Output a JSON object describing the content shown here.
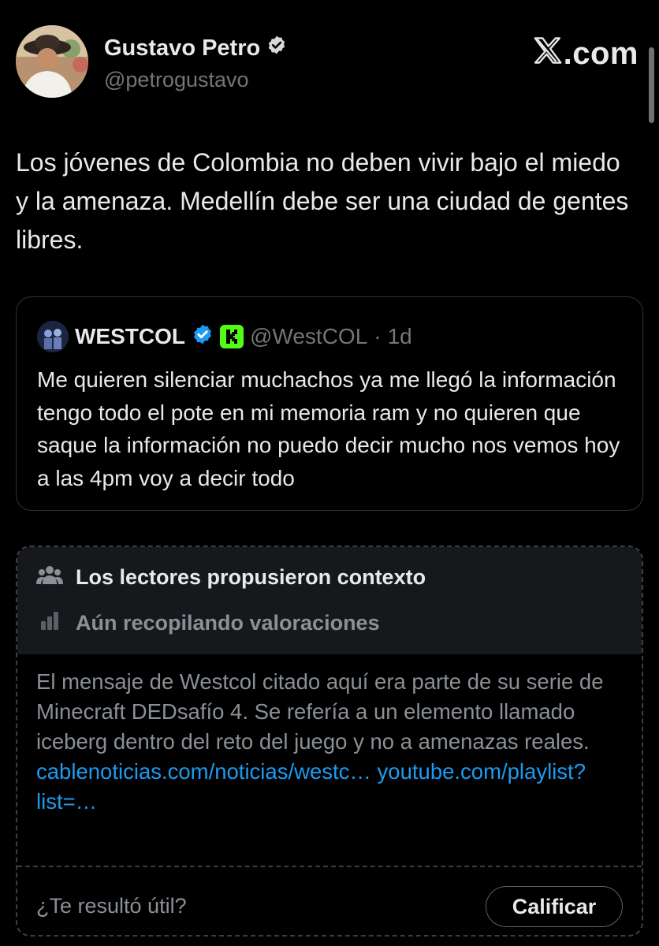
{
  "author": {
    "name": "Gustavo Petro",
    "handle": "@petrogustavo",
    "verified": true
  },
  "brand": {
    "domain_suffix": ".com"
  },
  "tweet": {
    "text": "Los jóvenes de Colombia no deben vivir bajo el miedo y la amenaza. Medellín debe ser una ciudad de gentes libres."
  },
  "quoted": {
    "name": "WESTCOL",
    "handle": "@WestCOL",
    "separator": "·",
    "time": "1d",
    "text": "Me quieren silenciar muchachos ya me llegó la información tengo todo el pote en mi memoria ram y no quieren que saque la información no puedo decir mucho nos vemos hoy a las 4pm voy a decir todo"
  },
  "community_note": {
    "title": "Los lectores propusieron contexto",
    "status": "Aún recopilando valoraciones",
    "body": "El mensaje de Westcol citado aquí era parte de su serie de Minecraft DEDsafío 4. Se refería a un elemento llamado iceberg dentro del reto del juego y no a amenazas reales.",
    "link1": "cablenoticias.com/noticias/westc…",
    "link2": "youtube.com/playlist?list=…",
    "question": "¿Te resultó útil?",
    "rate_label": "Calificar"
  },
  "colors": {
    "background": "#000000",
    "text": "#e7e9ea",
    "muted": "#71767b",
    "link": "#1d9bf0",
    "verified": "#1d9bf0",
    "kick": "#53fc18"
  },
  "icons": [
    "verified-badge-icon",
    "x-logo-icon",
    "kick-badge-icon",
    "people-icon",
    "bar-chart-icon"
  ]
}
